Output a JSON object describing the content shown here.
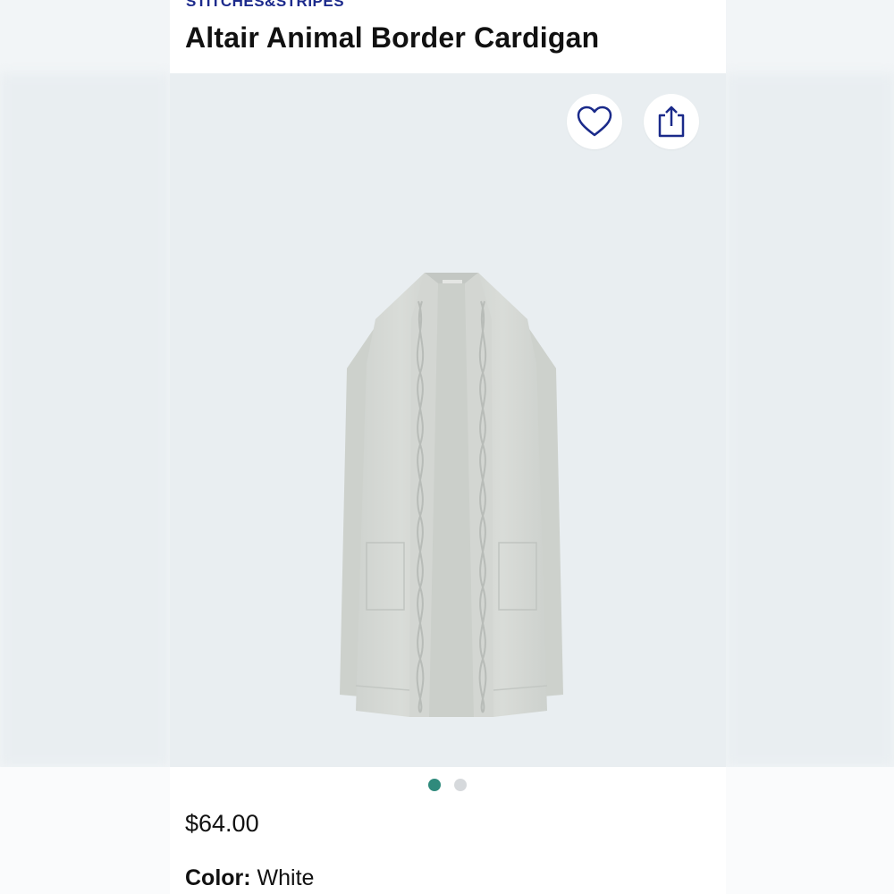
{
  "product": {
    "brand": "STITCHES&STRIPES",
    "title": "Altair Animal Border Cardigan",
    "price": "$64.00",
    "color_label": "Color:",
    "color_value": "White"
  },
  "gallery": {
    "current_index": 1,
    "total_images": 2,
    "favorite_icon": "heart-icon",
    "share_icon": "share-icon"
  },
  "colors": {
    "brand_text": "#1c2a8c",
    "active_dot": "#2f8a7c",
    "inactive_dot": "#d6d9dc",
    "image_background": "#e9eef1"
  }
}
